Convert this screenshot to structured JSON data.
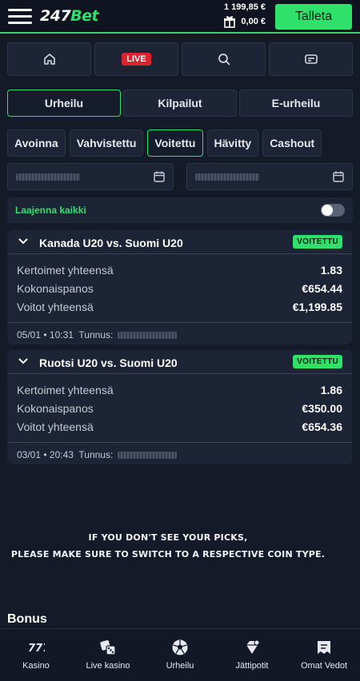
{
  "header": {
    "logo_num": "247",
    "logo_bet": "Bet",
    "balance": "1 199,85 €",
    "bonus_balance": "0,00 €",
    "deposit_label": "Talleta"
  },
  "topnav": {
    "items": [
      {
        "icon": "home-icon"
      },
      {
        "label": "LIVE"
      },
      {
        "icon": "search-icon"
      },
      {
        "icon": "betslip-icon"
      }
    ]
  },
  "categories": {
    "tabs": [
      {
        "label": "Urheilu",
        "active": true
      },
      {
        "label": "Kilpailut",
        "active": false
      },
      {
        "label": "E-urheilu",
        "active": false
      }
    ]
  },
  "filters": {
    "chips": [
      {
        "label": "Avoinna",
        "active": false
      },
      {
        "label": "Vahvistettu",
        "active": false
      },
      {
        "label": "Voitettu",
        "active": true
      },
      {
        "label": "Hävitty",
        "active": false
      },
      {
        "label": "Cashout",
        "active": false
      }
    ]
  },
  "expand": {
    "label": "Laajenna kaikki",
    "toggle_on": false
  },
  "bets": [
    {
      "match": "Kanada U20 vs. Suomi U20",
      "status": "VOITETTU",
      "rows": [
        {
          "k": "Kertoimet yhteensä",
          "v": "1.83"
        },
        {
          "k": "Kokonaispanos",
          "v": "€654.44"
        },
        {
          "k": "Voitot yhteensä",
          "v": "€1,199.85"
        }
      ],
      "datetime": "05/01 • 10:31",
      "id_label": "Tunnus:"
    },
    {
      "match": "Ruotsi U20 vs. Suomi U20",
      "status": "VOITETTU",
      "rows": [
        {
          "k": "Kertoimet yhteensä",
          "v": "1.86"
        },
        {
          "k": "Kokonaispanos",
          "v": "€350.00"
        },
        {
          "k": "Voitot yhteensä",
          "v": "€654.36"
        }
      ],
      "datetime": "03/01 • 20:43",
      "id_label": "Tunnus:"
    }
  ],
  "notice": {
    "line1": "IF YOU DON'T SEE YOUR PICKS,",
    "line2": "PLEASE MAKE SURE TO SWITCH TO A RESPECTIVE COIN TYPE."
  },
  "bonus_title": "Bonus",
  "bottomnav": {
    "items": [
      {
        "label": "Kasino",
        "icon": "casino-777-icon"
      },
      {
        "label": "Live kasino",
        "icon": "dice-icon"
      },
      {
        "label": "Urheilu",
        "icon": "soccer-ball-icon"
      },
      {
        "label": "Jättipotit",
        "icon": "jackpot-diamond-icon"
      },
      {
        "label": "Omat Vedot",
        "icon": "my-bets-icon"
      }
    ]
  },
  "colors": {
    "accent": "#2fe06a",
    "background": "#141a28",
    "card": "#1c2436",
    "live": "#d9232e"
  }
}
